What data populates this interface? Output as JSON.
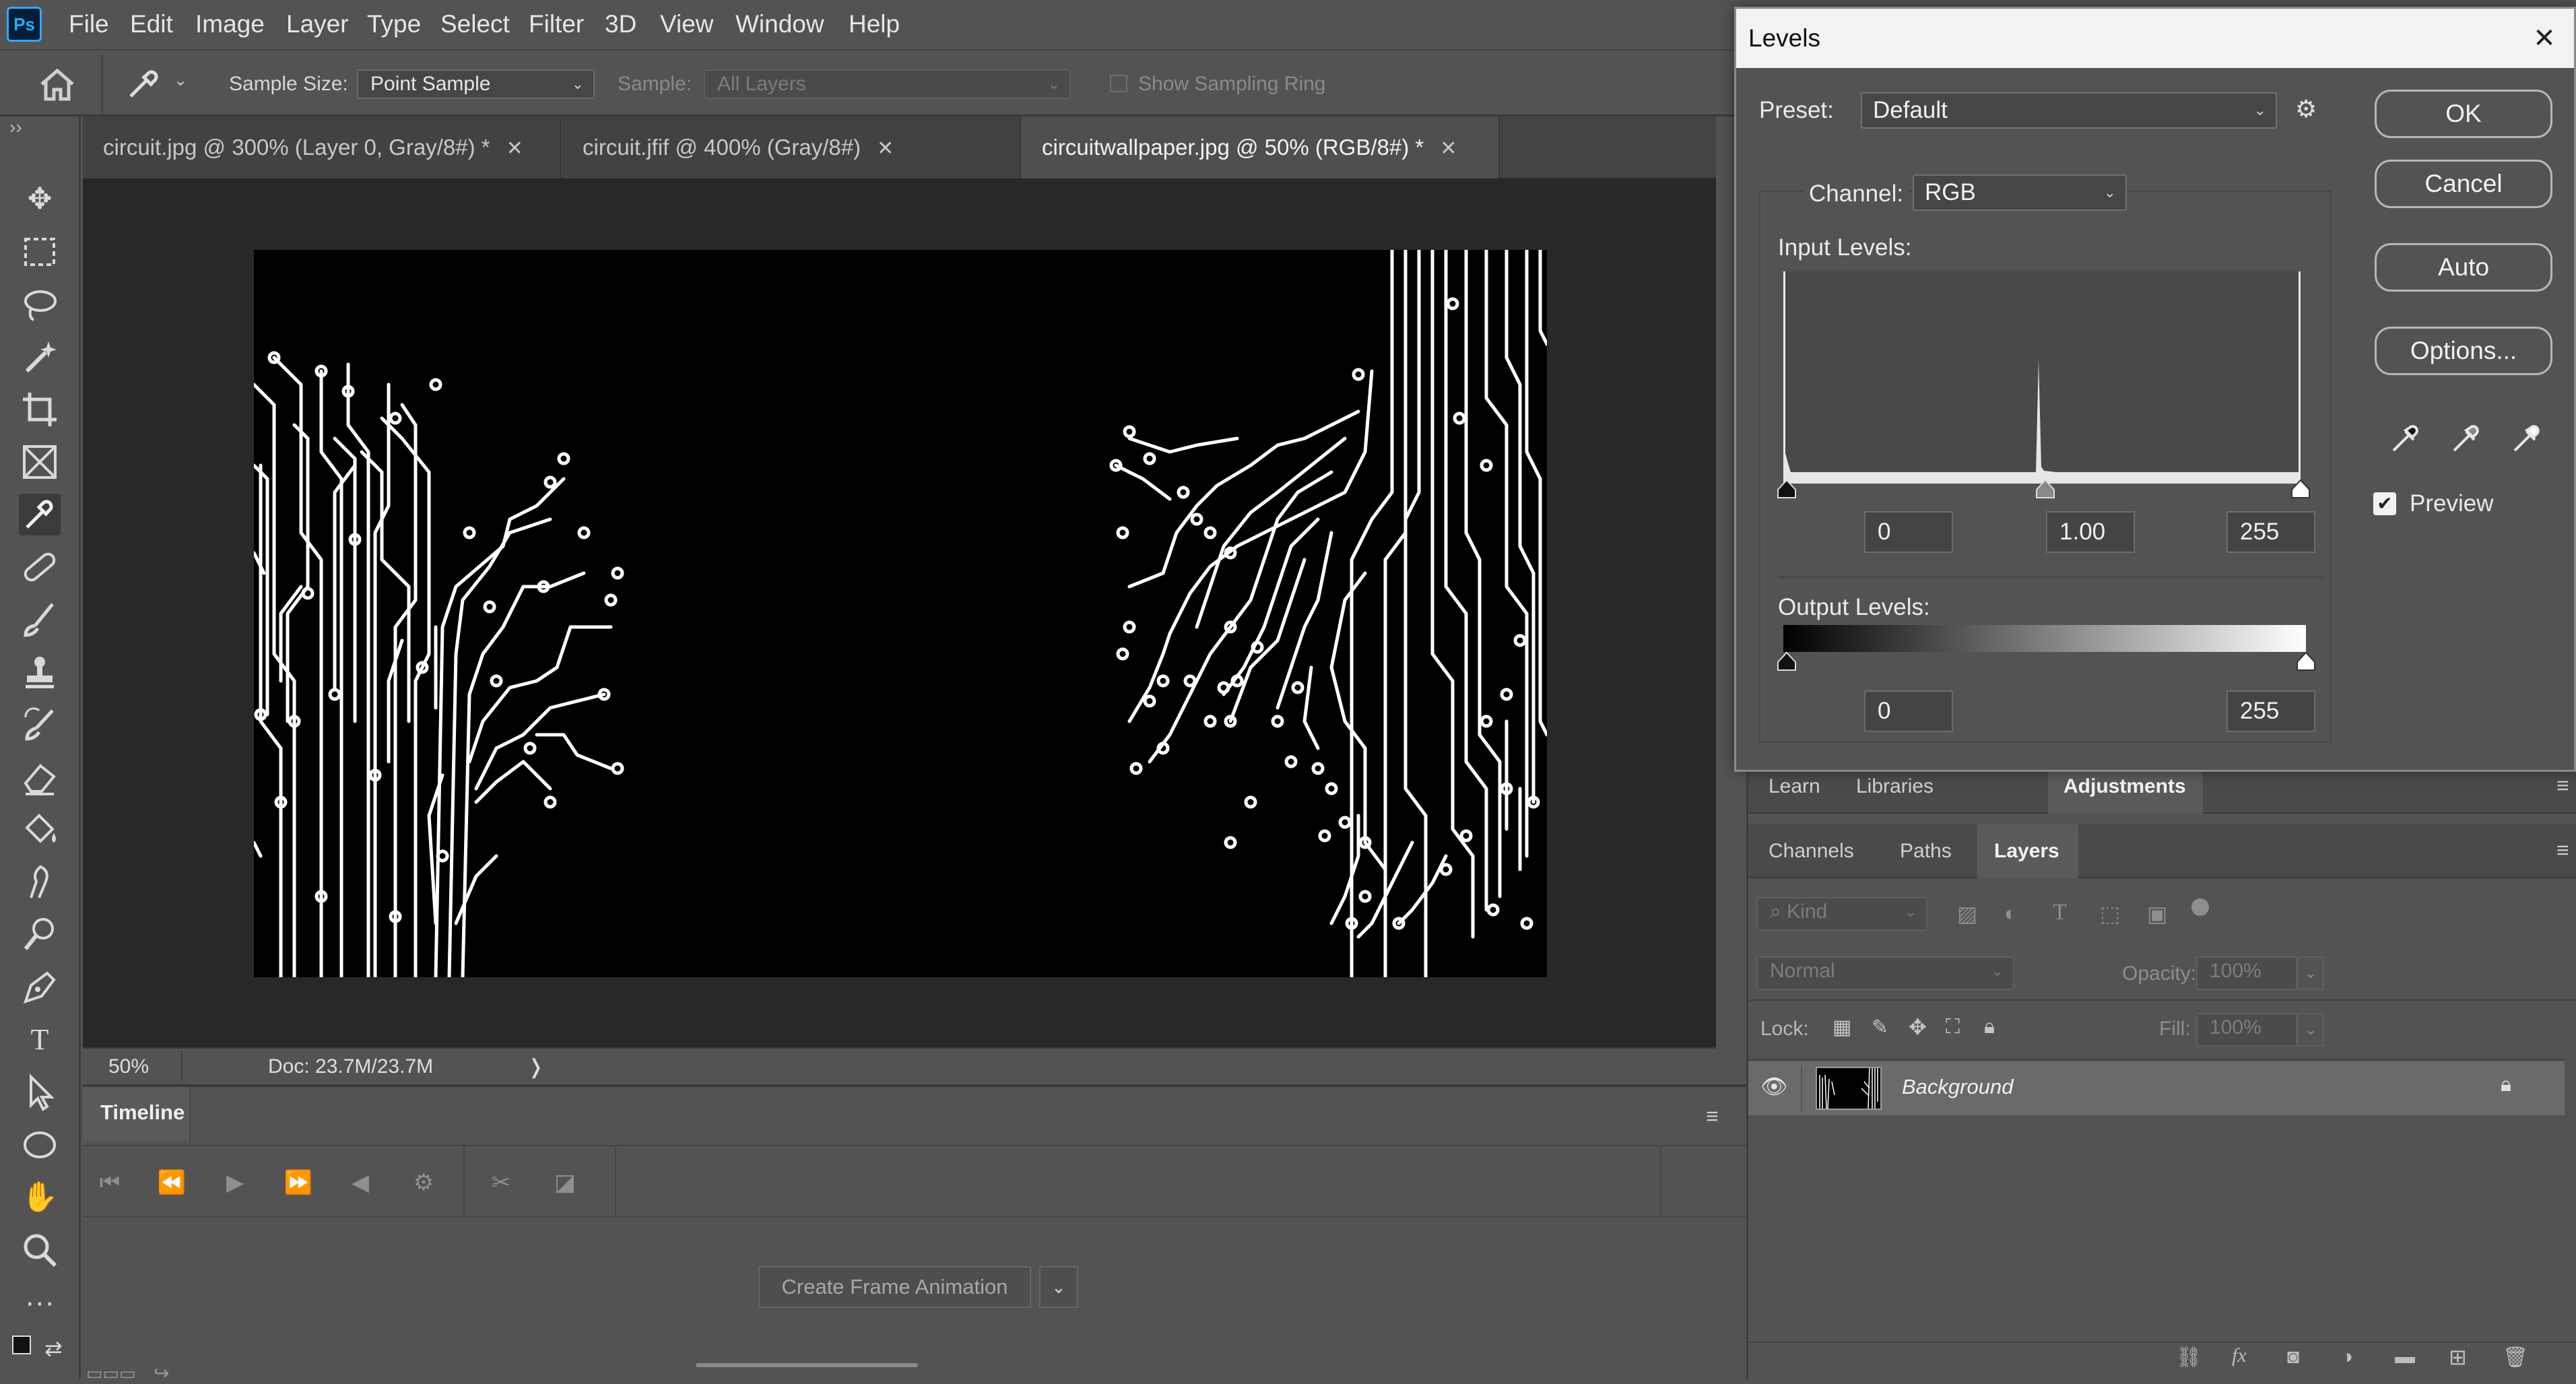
{
  "app": {
    "logo": "Ps",
    "menu": [
      "File",
      "Edit",
      "Image",
      "Layer",
      "Type",
      "Select",
      "Filter",
      "3D",
      "View",
      "Window",
      "Help"
    ]
  },
  "options_bar": {
    "sample_size_label": "Sample Size:",
    "sample_size_value": "Point Sample",
    "sample_label": "Sample:",
    "sample_value": "All Layers",
    "show_sampling_ring": "Show Sampling Ring",
    "collapse_glyph": "››"
  },
  "tabs": [
    {
      "label": "circuit.jpg @ 300% (Layer 0, Gray/8#) *",
      "active": false
    },
    {
      "label": "circuit.jfif @ 400% (Gray/8#)",
      "active": false
    },
    {
      "label": "circuitwallpaper.jpg @ 50% (RGB/8#) *",
      "active": true
    }
  ],
  "status": {
    "zoom": "50%",
    "doc": "Doc: 23.7M/23.7M",
    "arrow": "❭"
  },
  "timeline": {
    "title": "Timeline",
    "create_button": "Create Frame Animation"
  },
  "panels": {
    "top_tabs": [
      "Learn",
      "Libraries",
      "Adjustments"
    ],
    "layer_tabs": [
      "Channels",
      "Paths",
      "Layers"
    ],
    "kind": "Kind",
    "blend_mode": "Normal",
    "opacity_label": "Opacity:",
    "opacity_value": "100%",
    "lock_label": "Lock:",
    "fill_label": "Fill:",
    "fill_value": "100%",
    "layer_name": "Background"
  },
  "levels": {
    "title": "Levels",
    "preset_label": "Preset:",
    "preset_value": "Default",
    "channel_label": "Channel:",
    "channel_value": "RGB",
    "input_levels_label": "Input Levels:",
    "input_black": "0",
    "input_gamma": "1.00",
    "input_white": "255",
    "output_levels_label": "Output Levels:",
    "output_black": "0",
    "output_white": "255",
    "buttons": {
      "ok": "OK",
      "cancel": "Cancel",
      "auto": "Auto",
      "options": "Options..."
    },
    "preview_label": "Preview",
    "preview_checked": true
  }
}
